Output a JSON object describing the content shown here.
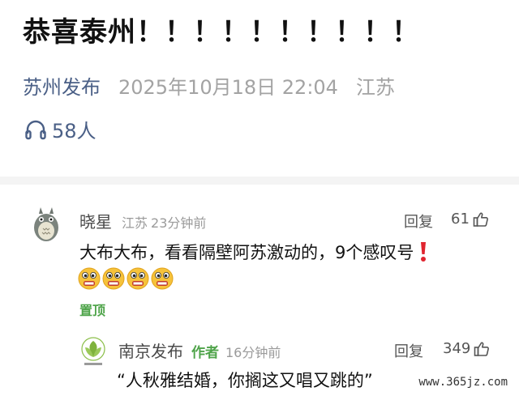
{
  "article": {
    "title": "恭喜泰州！！！！！！！！！！",
    "author": "苏州发布",
    "date": "2025年10月18日 22:04",
    "location": "江苏",
    "listen_count": "58人"
  },
  "comment": {
    "user": "晓星",
    "location": "江苏",
    "time": "23分钟前",
    "reply_label": "回复",
    "likes": "61",
    "text": "大布大布，看看隔壁阿苏激动的，9个感叹号",
    "pinned_label": "置顶"
  },
  "reply": {
    "user": "南京发布",
    "author_tag": "作者",
    "time": "16分钟前",
    "reply_label": "回复",
    "likes": "349",
    "text": "“人秋雅结婚，你搁这又唱又跳的”"
  },
  "watermark": "www.365jz.com",
  "colors": {
    "author_link": "#4a5f86",
    "pinned_green": "#4fa44a",
    "exclaim_red": "#e0242f"
  },
  "icons": {
    "listen": "headphones-icon",
    "like": "thumbs-up-icon",
    "emoji": "grimace-emoji-icon"
  }
}
